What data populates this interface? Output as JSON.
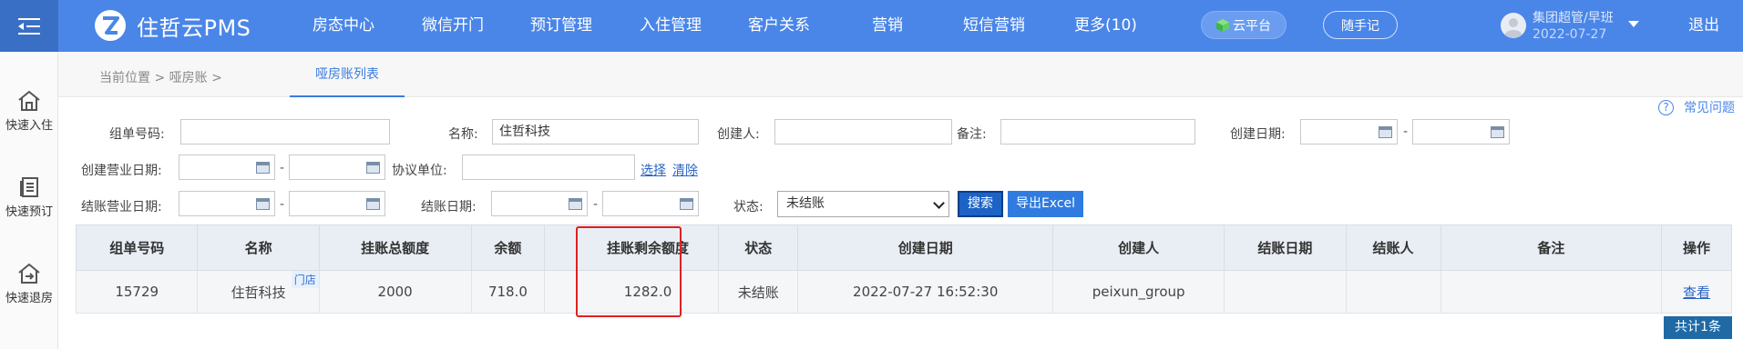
{
  "header": {
    "brand": "住哲云PMS",
    "nav": [
      "房态中心",
      "微信开门",
      "预订管理",
      "入住管理",
      "客户关系",
      "营销",
      "短信营销",
      "更多(10)"
    ],
    "cloud_label": "云平台",
    "note_label": "随手记",
    "user_name": "集团超管/早班",
    "user_date": "2022-07-27",
    "logout": "退出"
  },
  "quickbar": [
    "快速入住",
    "快速预订",
    "快速退房"
  ],
  "breadcrumb": {
    "text": "当前位置 > 哑房账 >",
    "active_tab": "哑房账列表"
  },
  "help_label": "常见问题",
  "filters": {
    "group_no_label": "组单号码:",
    "group_no_value": "",
    "name_label": "名称:",
    "name_value": "住哲科技",
    "creator_label": "创建人:",
    "creator_value": "",
    "remark_label": "备注:",
    "remark_value": "",
    "create_date_label": "创建日期:",
    "create_biz_date_label": "创建营业日期:",
    "agreement_label": "协议单位:",
    "agreement_value": "",
    "select_link": "选择",
    "clear_link": "清除",
    "settle_biz_date_label": "结账营业日期:",
    "settle_date_label": "结账日期:",
    "status_label": "状态:",
    "status_value": "未结账",
    "range_sep": "-",
    "search_label": "搜索",
    "export_label": "导出Excel"
  },
  "table": {
    "columns": [
      "组单号码",
      "名称",
      "挂账总额度",
      "余额",
      "",
      "挂账剩余额度",
      "状态",
      "创建日期",
      "创建人",
      "结账日期",
      "结账人",
      "备注",
      "操作"
    ],
    "rows": [
      {
        "group_no": "15729",
        "name": "住哲科技",
        "badge": "门店",
        "total_credit": "2000",
        "balance": "718.0",
        "blank": "",
        "remaining_credit": "1282.0",
        "status": "未结账",
        "created": "2022-07-27 16:52:30",
        "creator": "peixun_group",
        "settle_date": "",
        "settler": "",
        "remark": "",
        "action": "查看"
      }
    ],
    "total_label": "共计1条"
  },
  "colors": {
    "topbar": "#4a86e8",
    "accent": "#3b7be0",
    "highlight": "#e02020"
  }
}
